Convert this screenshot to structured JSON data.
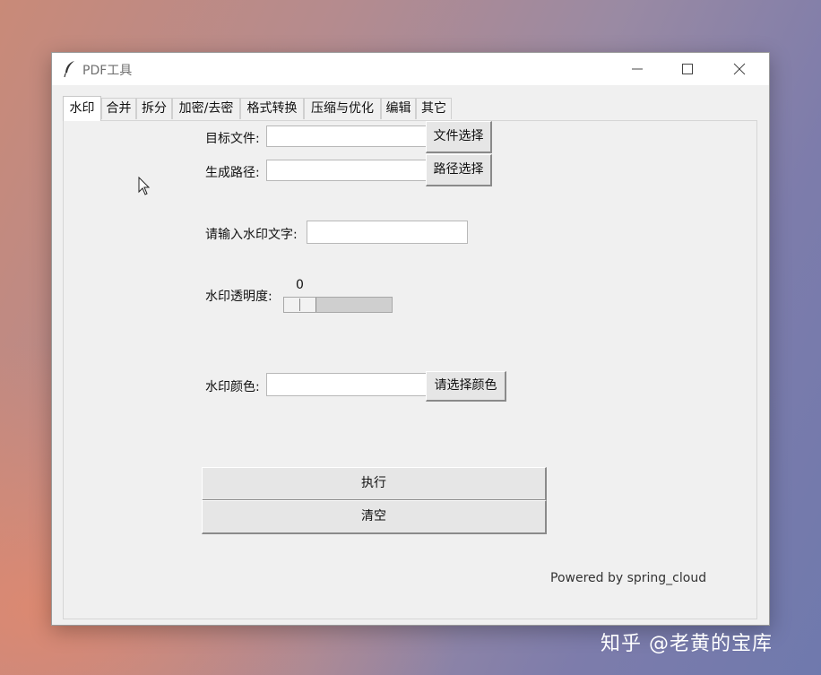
{
  "window": {
    "title": "PDF工具",
    "icon": "feather-icon",
    "controls": [
      "minimize-icon",
      "maximize-icon",
      "close-icon"
    ]
  },
  "tabs": [
    {
      "label": "水印",
      "active": true
    },
    {
      "label": "合并"
    },
    {
      "label": "拆分"
    },
    {
      "label": "加密/去密"
    },
    {
      "label": "格式转换"
    },
    {
      "label": "压缩与优化"
    },
    {
      "label": "编辑"
    },
    {
      "label": "其它"
    }
  ],
  "watermark_tab": {
    "target_file_label": "目标文件:",
    "target_file_value": "",
    "file_select_button": "文件选择",
    "output_path_label": "生成路径:",
    "output_path_value": "",
    "path_select_button": "路径选择",
    "text_label": "请输入水印文字:",
    "text_value": "",
    "opacity_label": "水印透明度:",
    "opacity_value": "0",
    "color_label": "水印颜色:",
    "color_value": "",
    "color_button": "请选择颜色",
    "execute_button": "执行",
    "clear_button": "清空",
    "footer": "Powered by spring_cloud"
  },
  "overlay_watermark": "知乎 @老黄的宝库"
}
